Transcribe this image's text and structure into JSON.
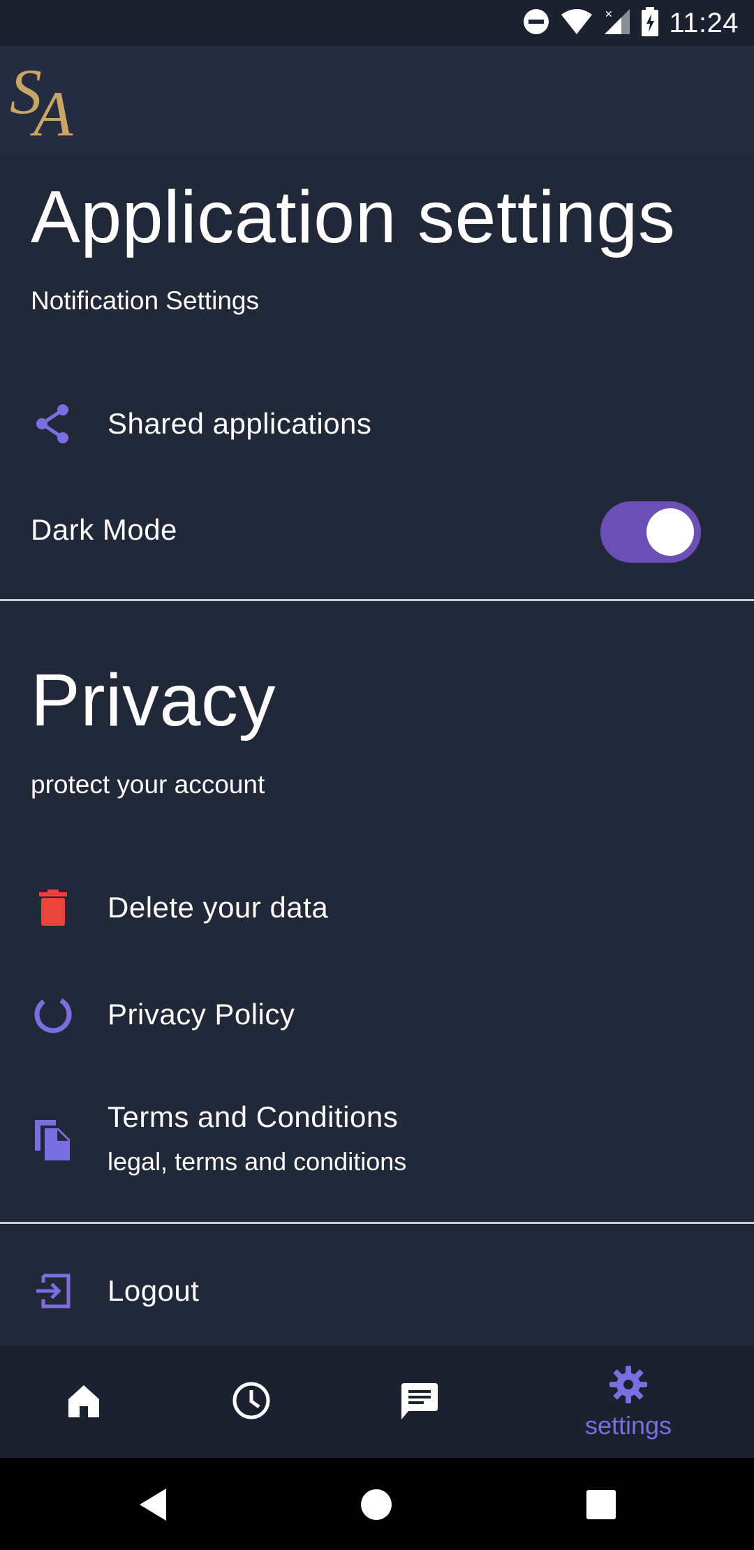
{
  "status_bar": {
    "time": "11:24"
  },
  "app_bar": {
    "logo": "SA"
  },
  "application_settings": {
    "title": "Application settings",
    "subtitle": "Notification Settings",
    "shared_label": "Shared applications",
    "dark_mode_label": "Dark Mode",
    "dark_mode_on": true
  },
  "privacy": {
    "title": "Privacy",
    "subtitle": "protect your account",
    "delete_label": "Delete your data",
    "policy_label": "Privacy Policy",
    "terms_label": "Terms and Conditions",
    "terms_sub": "legal, terms and conditions"
  },
  "logout": {
    "label": "Logout"
  },
  "bottom_nav": {
    "items": [
      {
        "icon": "home-icon"
      },
      {
        "icon": "clock-icon"
      },
      {
        "icon": "message-icon"
      },
      {
        "icon": "gear-icon",
        "label": "settings",
        "active": true
      }
    ]
  },
  "colors": {
    "background": "#212838",
    "accent": "#7a6fe0",
    "toggle": "#6b4fb5",
    "delete": "#e8443a",
    "logo": "#c8a766"
  }
}
